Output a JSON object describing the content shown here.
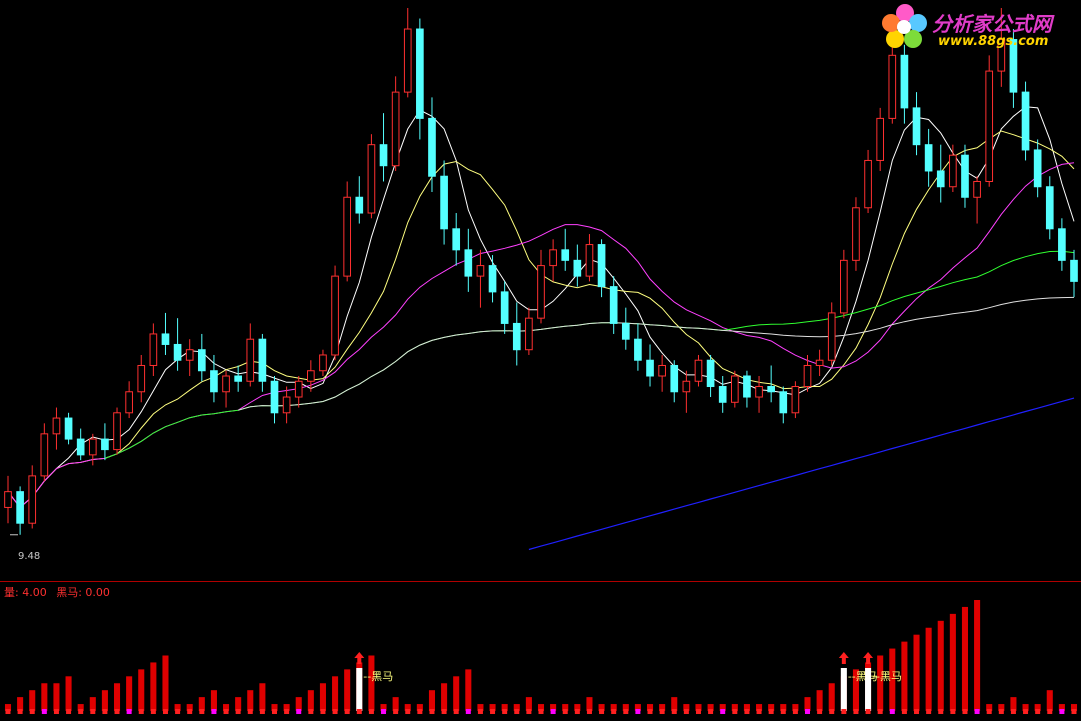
{
  "watermark": {
    "name": "分析家公式网",
    "url": "www.88gs.com"
  },
  "price_panel": {
    "low_label": "9.48"
  },
  "indicator_panel": {
    "label_volume": "量: 4.00",
    "label_heima": "黑马: 0.00",
    "signal_text": "黑马"
  },
  "colors": {
    "background": "#000000",
    "up_candle": "#ff3030",
    "down_candle": "#54ffff",
    "ma5": "#ffffff",
    "ma10": "#ffff80",
    "ma20": "#ff40ff",
    "ma60": "#30ff30",
    "ma120": "#e0e0e0",
    "ma250": "#2020ff",
    "volume_bar": "#e00000",
    "signal_bar": "#ffffff",
    "dot_red": "#ff2020",
    "dot_magenta": "#ff00ff"
  },
  "chart_data": {
    "type": "candlestick",
    "price_range": [
      9.0,
      19.5
    ],
    "low_marker": 9.48,
    "candles": [
      {
        "o": 10.0,
        "h": 10.6,
        "l": 9.7,
        "c": 10.3
      },
      {
        "o": 10.3,
        "h": 10.4,
        "l": 9.48,
        "c": 9.7
      },
      {
        "o": 9.7,
        "h": 10.8,
        "l": 9.6,
        "c": 10.6
      },
      {
        "o": 10.6,
        "h": 11.6,
        "l": 10.5,
        "c": 11.4
      },
      {
        "o": 11.4,
        "h": 11.9,
        "l": 11.1,
        "c": 11.7
      },
      {
        "o": 11.7,
        "h": 11.8,
        "l": 11.2,
        "c": 11.3
      },
      {
        "o": 11.3,
        "h": 11.5,
        "l": 10.9,
        "c": 11.0
      },
      {
        "o": 11.0,
        "h": 11.4,
        "l": 10.8,
        "c": 11.3
      },
      {
        "o": 11.3,
        "h": 11.6,
        "l": 10.9,
        "c": 11.1
      },
      {
        "o": 11.1,
        "h": 11.9,
        "l": 11.0,
        "c": 11.8
      },
      {
        "o": 11.8,
        "h": 12.4,
        "l": 11.7,
        "c": 12.2
      },
      {
        "o": 12.2,
        "h": 12.9,
        "l": 12.0,
        "c": 12.7
      },
      {
        "o": 12.7,
        "h": 13.5,
        "l": 12.5,
        "c": 13.3
      },
      {
        "o": 13.3,
        "h": 13.7,
        "l": 12.9,
        "c": 13.1
      },
      {
        "o": 13.1,
        "h": 13.6,
        "l": 12.6,
        "c": 12.8
      },
      {
        "o": 12.8,
        "h": 13.2,
        "l": 12.5,
        "c": 13.0
      },
      {
        "o": 13.0,
        "h": 13.3,
        "l": 12.4,
        "c": 12.6
      },
      {
        "o": 12.6,
        "h": 12.9,
        "l": 12.0,
        "c": 12.2
      },
      {
        "o": 12.2,
        "h": 12.6,
        "l": 11.9,
        "c": 12.5
      },
      {
        "o": 12.5,
        "h": 12.7,
        "l": 12.2,
        "c": 12.4
      },
      {
        "o": 12.4,
        "h": 13.5,
        "l": 12.3,
        "c": 13.2
      },
      {
        "o": 13.2,
        "h": 13.3,
        "l": 12.2,
        "c": 12.4
      },
      {
        "o": 12.4,
        "h": 12.5,
        "l": 11.6,
        "c": 11.8
      },
      {
        "o": 11.8,
        "h": 12.3,
        "l": 11.6,
        "c": 12.1
      },
      {
        "o": 12.1,
        "h": 12.5,
        "l": 11.9,
        "c": 12.4
      },
      {
        "o": 12.4,
        "h": 12.8,
        "l": 12.2,
        "c": 12.6
      },
      {
        "o": 12.6,
        "h": 13.0,
        "l": 12.5,
        "c": 12.9
      },
      {
        "o": 12.9,
        "h": 14.6,
        "l": 12.8,
        "c": 14.4
      },
      {
        "o": 14.4,
        "h": 16.2,
        "l": 14.3,
        "c": 15.9
      },
      {
        "o": 15.9,
        "h": 16.3,
        "l": 15.4,
        "c": 15.6
      },
      {
        "o": 15.6,
        "h": 17.1,
        "l": 15.5,
        "c": 16.9
      },
      {
        "o": 16.9,
        "h": 17.5,
        "l": 16.2,
        "c": 16.5
      },
      {
        "o": 16.5,
        "h": 18.2,
        "l": 16.4,
        "c": 17.9
      },
      {
        "o": 17.9,
        "h": 19.5,
        "l": 17.8,
        "c": 19.1
      },
      {
        "o": 19.1,
        "h": 19.3,
        "l": 17.0,
        "c": 17.4
      },
      {
        "o": 17.4,
        "h": 17.8,
        "l": 16.0,
        "c": 16.3
      },
      {
        "o": 16.3,
        "h": 16.6,
        "l": 15.0,
        "c": 15.3
      },
      {
        "o": 15.3,
        "h": 15.6,
        "l": 14.6,
        "c": 14.9
      },
      {
        "o": 14.9,
        "h": 15.3,
        "l": 14.1,
        "c": 14.4
      },
      {
        "o": 14.4,
        "h": 14.9,
        "l": 13.8,
        "c": 14.6
      },
      {
        "o": 14.6,
        "h": 14.8,
        "l": 13.9,
        "c": 14.1
      },
      {
        "o": 14.1,
        "h": 14.3,
        "l": 13.3,
        "c": 13.5
      },
      {
        "o": 13.5,
        "h": 13.9,
        "l": 12.7,
        "c": 13.0
      },
      {
        "o": 13.0,
        "h": 13.8,
        "l": 12.9,
        "c": 13.6
      },
      {
        "o": 13.6,
        "h": 14.9,
        "l": 13.5,
        "c": 14.6
      },
      {
        "o": 14.6,
        "h": 15.1,
        "l": 14.3,
        "c": 14.9
      },
      {
        "o": 14.9,
        "h": 15.3,
        "l": 14.5,
        "c": 14.7
      },
      {
        "o": 14.7,
        "h": 15.0,
        "l": 14.2,
        "c": 14.4
      },
      {
        "o": 14.4,
        "h": 15.2,
        "l": 14.3,
        "c": 15.0
      },
      {
        "o": 15.0,
        "h": 15.1,
        "l": 14.0,
        "c": 14.2
      },
      {
        "o": 14.2,
        "h": 14.4,
        "l": 13.3,
        "c": 13.5
      },
      {
        "o": 13.5,
        "h": 13.8,
        "l": 13.0,
        "c": 13.2
      },
      {
        "o": 13.2,
        "h": 13.5,
        "l": 12.6,
        "c": 12.8
      },
      {
        "o": 12.8,
        "h": 13.1,
        "l": 12.3,
        "c": 12.5
      },
      {
        "o": 12.5,
        "h": 12.9,
        "l": 12.2,
        "c": 12.7
      },
      {
        "o": 12.7,
        "h": 12.8,
        "l": 12.0,
        "c": 12.2
      },
      {
        "o": 12.2,
        "h": 12.6,
        "l": 11.8,
        "c": 12.4
      },
      {
        "o": 12.4,
        "h": 12.9,
        "l": 12.3,
        "c": 12.8
      },
      {
        "o": 12.8,
        "h": 12.9,
        "l": 12.1,
        "c": 12.3
      },
      {
        "o": 12.3,
        "h": 12.5,
        "l": 11.8,
        "c": 12.0
      },
      {
        "o": 12.0,
        "h": 12.6,
        "l": 11.9,
        "c": 12.5
      },
      {
        "o": 12.5,
        "h": 12.6,
        "l": 11.9,
        "c": 12.1
      },
      {
        "o": 12.1,
        "h": 12.5,
        "l": 11.8,
        "c": 12.3
      },
      {
        "o": 12.3,
        "h": 12.7,
        "l": 12.0,
        "c": 12.2
      },
      {
        "o": 12.2,
        "h": 12.3,
        "l": 11.6,
        "c": 11.8
      },
      {
        "o": 11.8,
        "h": 12.4,
        "l": 11.7,
        "c": 12.3
      },
      {
        "o": 12.3,
        "h": 12.9,
        "l": 12.2,
        "c": 12.7
      },
      {
        "o": 12.7,
        "h": 13.0,
        "l": 12.5,
        "c": 12.8
      },
      {
        "o": 12.8,
        "h": 13.9,
        "l": 12.7,
        "c": 13.7
      },
      {
        "o": 13.7,
        "h": 14.9,
        "l": 13.6,
        "c": 14.7
      },
      {
        "o": 14.7,
        "h": 15.9,
        "l": 14.5,
        "c": 15.7
      },
      {
        "o": 15.7,
        "h": 16.8,
        "l": 15.6,
        "c": 16.6
      },
      {
        "o": 16.6,
        "h": 17.6,
        "l": 16.4,
        "c": 17.4
      },
      {
        "o": 17.4,
        "h": 18.9,
        "l": 17.3,
        "c": 18.6
      },
      {
        "o": 18.6,
        "h": 18.8,
        "l": 17.3,
        "c": 17.6
      },
      {
        "o": 17.6,
        "h": 17.9,
        "l": 16.7,
        "c": 16.9
      },
      {
        "o": 16.9,
        "h": 17.2,
        "l": 16.1,
        "c": 16.4
      },
      {
        "o": 16.4,
        "h": 16.9,
        "l": 15.8,
        "c": 16.1
      },
      {
        "o": 16.1,
        "h": 16.9,
        "l": 16.0,
        "c": 16.7
      },
      {
        "o": 16.7,
        "h": 16.9,
        "l": 15.7,
        "c": 15.9
      },
      {
        "o": 15.9,
        "h": 16.3,
        "l": 15.4,
        "c": 16.2
      },
      {
        "o": 16.2,
        "h": 18.6,
        "l": 16.1,
        "c": 18.3
      },
      {
        "o": 18.3,
        "h": 19.5,
        "l": 18.0,
        "c": 18.9
      },
      {
        "o": 18.9,
        "h": 19.1,
        "l": 17.6,
        "c": 17.9
      },
      {
        "o": 17.9,
        "h": 18.1,
        "l": 16.6,
        "c": 16.8
      },
      {
        "o": 16.8,
        "h": 17.0,
        "l": 15.9,
        "c": 16.1
      },
      {
        "o": 16.1,
        "h": 16.3,
        "l": 15.1,
        "c": 15.3
      },
      {
        "o": 15.3,
        "h": 15.5,
        "l": 14.5,
        "c": 14.7
      },
      {
        "o": 14.7,
        "h": 14.9,
        "l": 14.0,
        "c": 14.3
      }
    ],
    "volume": [
      1,
      2,
      3,
      4,
      4,
      5,
      1,
      2,
      3,
      4,
      5,
      6,
      7,
      8,
      1,
      1,
      2,
      3,
      1,
      2,
      3,
      4,
      1,
      1,
      2,
      3,
      4,
      5,
      6,
      7,
      8,
      1,
      2,
      1,
      1,
      3,
      4,
      5,
      6,
      1,
      1,
      1,
      1,
      2,
      1,
      1,
      1,
      1,
      2,
      1,
      1,
      1,
      1,
      1,
      1,
      2,
      1,
      1,
      1,
      1,
      1,
      1,
      1,
      1,
      1,
      1,
      2,
      3,
      4,
      5,
      6,
      7,
      8,
      9,
      10,
      11,
      12,
      13,
      14,
      15,
      16,
      1,
      1,
      2,
      1,
      1,
      3,
      1,
      1,
      1
    ],
    "heima_signals": [
      29,
      69,
      71
    ],
    "heima_values": [
      0.0
    ]
  }
}
